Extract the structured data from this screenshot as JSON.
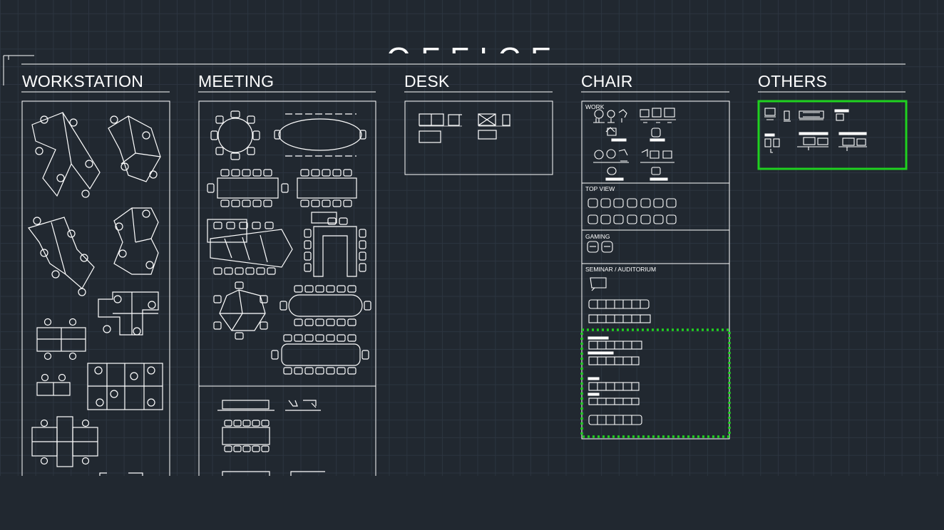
{
  "drawing": {
    "title_partial": "OFFICE",
    "categories": {
      "workstation": "WORKSTATION",
      "meeting": "MEETING",
      "desk": "DESK",
      "chair": "CHAIR",
      "others": "OTHERS"
    },
    "chair_sections": {
      "work": "WORK",
      "top_view": "TOP VIEW",
      "gaming": "GAMING",
      "seminar": "SEMINAR / AUDITORIUM"
    }
  },
  "highlights": {
    "others_selection_color": "#1fd11f",
    "seminar_selection_color": "#1fd11f"
  },
  "colors": {
    "background": "#212830",
    "grid": "#2c3540",
    "linework": "#ffffff"
  }
}
